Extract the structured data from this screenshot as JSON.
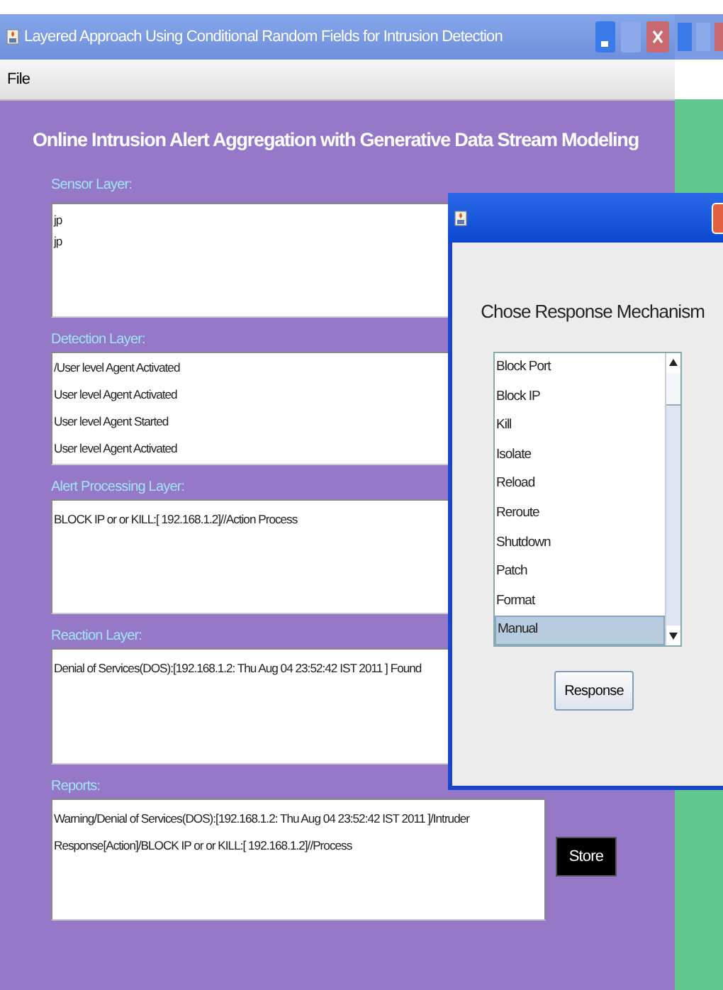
{
  "window": {
    "title": "Layered Approach Using Conditional Random Fields for Intrusion Detection",
    "maximize_disabled": true
  },
  "menu": [
    "File"
  ],
  "heading": "Online Intrusion Alert Aggregation with Generative Data Stream Modeling",
  "panels": [
    {
      "label": "Sensor Layer:",
      "lines": [
        "jp",
        "jp"
      ]
    },
    {
      "label": "Detection Layer:",
      "lines": [
        "/User level Agent Activated",
        "User level Agent Activated",
        "User level Agent Started",
        "User level Agent Activated"
      ]
    },
    {
      "label": "Alert Processing Layer:",
      "lines": [
        "BLOCK IP or or KILL:[ 192.168.1.2]//Action Process"
      ]
    },
    {
      "label": "Reaction Layer:",
      "lines": [
        "Denial of Services(DOS):[192.168.1.2: Thu Aug 04 23:52:42 IST 2011 ]  Found"
      ]
    },
    {
      "label": "Reports:",
      "lines": [
        "Warning/Denial of Services(DOS):[192.168.1.2: Thu Aug 04 23:52:42 IST 2011 ]/Intruder",
        "Response[Action]/BLOCK IP or or KILL:[ 192.168.1.2]//Process"
      ]
    }
  ],
  "store_button": "Store",
  "dialog": {
    "heading": "Chose Response Mechanism",
    "items": [
      {
        "label": "Block Port",
        "selected": false
      },
      {
        "label": "Block IP",
        "selected": false
      },
      {
        "label": "Kill",
        "selected": false
      },
      {
        "label": "Isolate",
        "selected": false
      },
      {
        "label": "Reload",
        "selected": false
      },
      {
        "label": "Reroute",
        "selected": false
      },
      {
        "label": "Shutdown",
        "selected": false
      },
      {
        "label": "Patch",
        "selected": false
      },
      {
        "label": "Format",
        "selected": false
      },
      {
        "label": "Manual",
        "selected": true
      }
    ],
    "button": "Response"
  }
}
